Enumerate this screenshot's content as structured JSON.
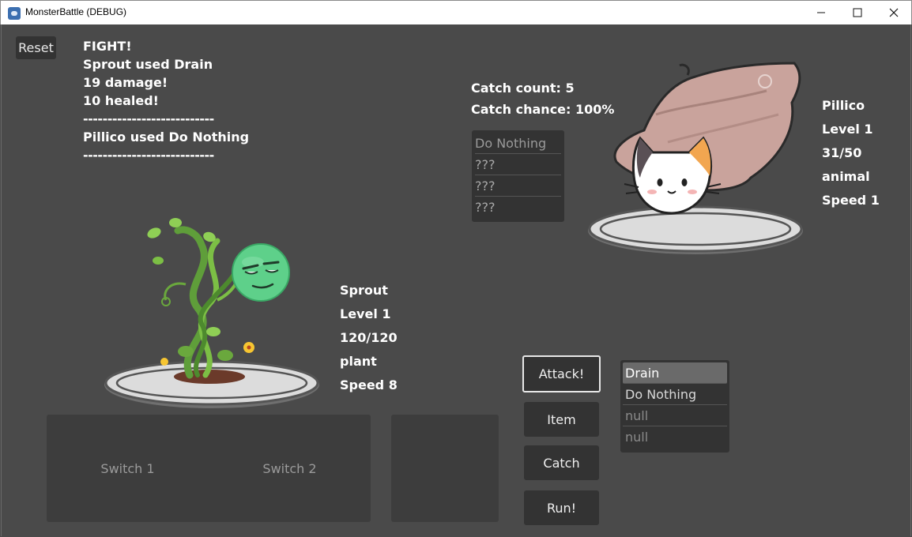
{
  "window": {
    "title": "MonsterBattle (DEBUG)",
    "min_glyph": "—",
    "max_glyph": "☐",
    "close_glyph": "✕"
  },
  "reset_label": "Reset",
  "battle_log": [
    "FIGHT!",
    "Sprout used Drain",
    "19 damage!",
    "10 healed!",
    "---------------------------",
    "Pillico used Do Nothing",
    "---------------------------"
  ],
  "catch": {
    "count_text": "Catch count: 5",
    "chance_text": "Catch chance: 100%"
  },
  "enemy": {
    "name": "Pillico",
    "level": "Level 1",
    "hp": "31/50",
    "type": "animal",
    "speed": "Speed 1",
    "moves": [
      "Do Nothing",
      "???",
      "???",
      "???"
    ]
  },
  "player": {
    "name": "Sprout",
    "level": "Level 1",
    "hp": "120/120",
    "type": "plant",
    "speed": "Speed 8",
    "moves": [
      "Drain",
      "Do Nothing",
      "null",
      "null"
    ]
  },
  "commands": {
    "attack": "Attack!",
    "item": "Item",
    "catch": "Catch",
    "run": "Run!"
  },
  "switches": [
    "Switch 1",
    "Switch 2"
  ],
  "colors": {
    "background": "#4a4a4a",
    "panel": "#333333",
    "text": "#ffffff"
  }
}
